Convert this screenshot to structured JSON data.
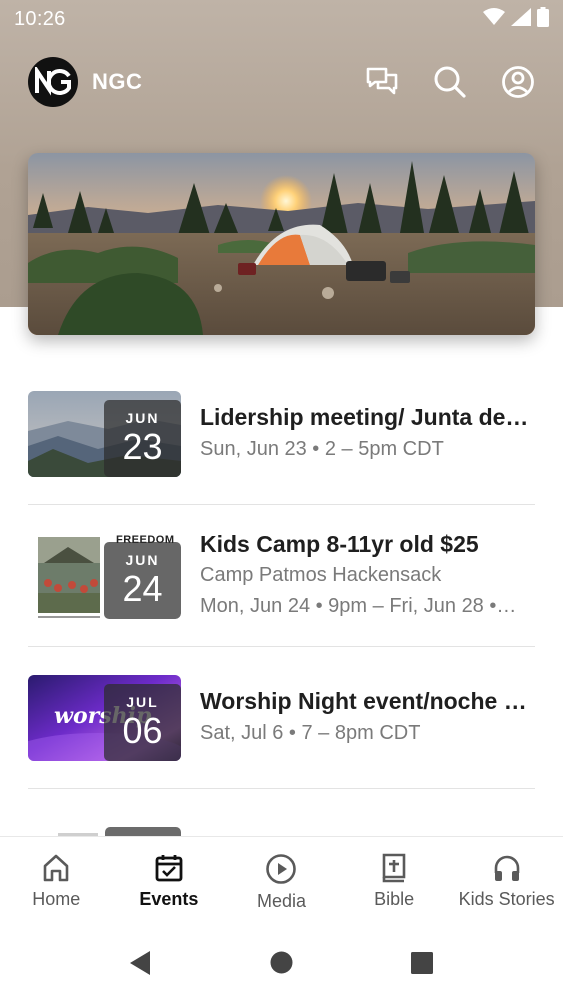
{
  "status_bar": {
    "time": "10:26",
    "icons": [
      "wifi-icon",
      "signal-icon",
      "battery-icon"
    ]
  },
  "header": {
    "logo_text": "NG",
    "app_name": "NGC",
    "actions": [
      "chat-icon",
      "search-icon",
      "account-icon"
    ]
  },
  "hero": {
    "image": "campsite tent at sunset"
  },
  "events": [
    {
      "month": "JUN",
      "day": "23",
      "title": "Lidership meeting/ Junta de…",
      "line1": "Sun, Jun 23 • 2 – 5pm CDT",
      "line2": ""
    },
    {
      "month": "JUN",
      "day": "24",
      "title": "Kids Camp 8-11yr old $25",
      "line1": "Camp Patmos Hackensack",
      "line2": "Mon, Jun 24 • 9pm – Fri, Jun 28 •…",
      "thumb_caption": "FREEDOM"
    },
    {
      "month": "JUL",
      "day": "06",
      "title": "Worship Night event/noche …",
      "line1": "Sat, Jul 6 • 7 – 8pm CDT",
      "line2": "",
      "thumb_caption": "worship"
    }
  ],
  "bottom_nav": {
    "items": [
      {
        "label": "Home",
        "icon": "home-icon",
        "active": false
      },
      {
        "label": "Events",
        "icon": "calendar-icon",
        "active": true
      },
      {
        "label": "Media",
        "icon": "play-icon",
        "active": false
      },
      {
        "label": "Bible",
        "icon": "bible-icon",
        "active": false
      },
      {
        "label": "Kids Stories",
        "icon": "headphones-icon",
        "active": false
      }
    ]
  },
  "colors": {
    "header_bg": "#b0a294",
    "text_primary": "#1f1f1f",
    "text_secondary": "#7a7a7a",
    "active_nav": "#111111"
  }
}
